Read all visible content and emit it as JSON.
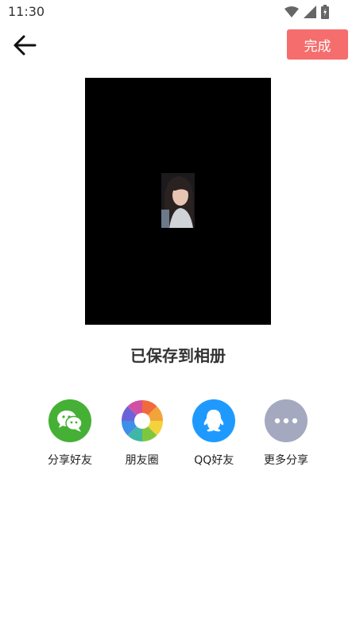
{
  "status": {
    "time": "11:30"
  },
  "header": {
    "done_label": "完成"
  },
  "main": {
    "saved_text": "已保存到相册"
  },
  "share": [
    {
      "label": "分享好友",
      "icon": "wechat-icon",
      "color": "#45b035"
    },
    {
      "label": "朋友圈",
      "icon": "moments-icon",
      "color": "#ffffff"
    },
    {
      "label": "QQ好友",
      "icon": "qq-icon",
      "color": "#1e9aff"
    },
    {
      "label": "更多分享",
      "icon": "more-icon",
      "color": "#a4a9bf"
    }
  ]
}
